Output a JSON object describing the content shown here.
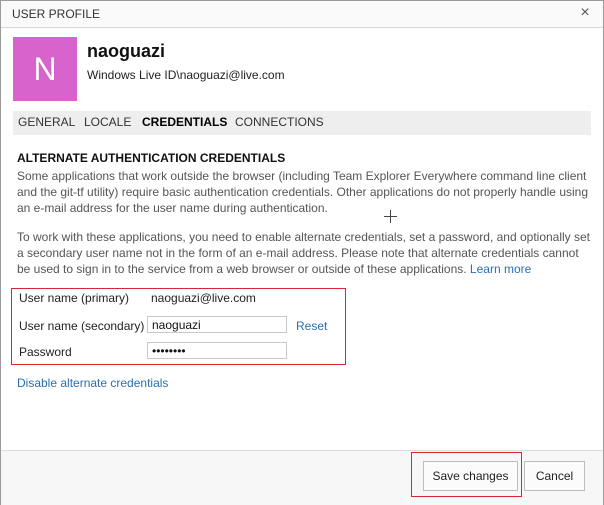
{
  "dialog": {
    "title": "USER PROFILE",
    "close_glyph": "×"
  },
  "profile": {
    "avatar_initial": "N",
    "avatar_color": "#d763cc",
    "name": "naoguazi",
    "id_line": "Windows Live ID\\naoguazi@live.com"
  },
  "tabs": [
    {
      "label": "GENERAL",
      "active": false
    },
    {
      "label": "LOCALE",
      "active": false
    },
    {
      "label": "CREDENTIALS",
      "active": true
    },
    {
      "label": "CONNECTIONS",
      "active": false
    }
  ],
  "credentials": {
    "heading": "ALTERNATE AUTHENTICATION CREDENTIALS",
    "para1": "Some applications that work outside the browser (including Team Explorer Everywhere command line client and the git-tf utility) require basic authentication credentials. Other applications do not properly handle using an e-mail address for the user name during authentication.",
    "para2": "To work with these applications, you need to enable alternate credentials, set a password, and optionally set a secondary user name not in the form of an e-mail address. Please note that alternate credentials cannot be used to sign in to the service from a web browser or outside of these applications.",
    "learn_more": "Learn more",
    "fields": {
      "primary_label": "User name (primary)",
      "primary_value": "naoguazi@live.com",
      "secondary_label": "User name (secondary)",
      "secondary_value": "naoguazi",
      "password_label": "Password",
      "password_value": "••••••••"
    },
    "reset": "Reset",
    "disable": "Disable alternate credentials"
  },
  "footer": {
    "save": "Save changes",
    "cancel": "Cancel"
  },
  "colors": {
    "link": "#2a6fb0",
    "highlight_border": "#d9262f",
    "tabbar_bg": "#eeeeee"
  }
}
